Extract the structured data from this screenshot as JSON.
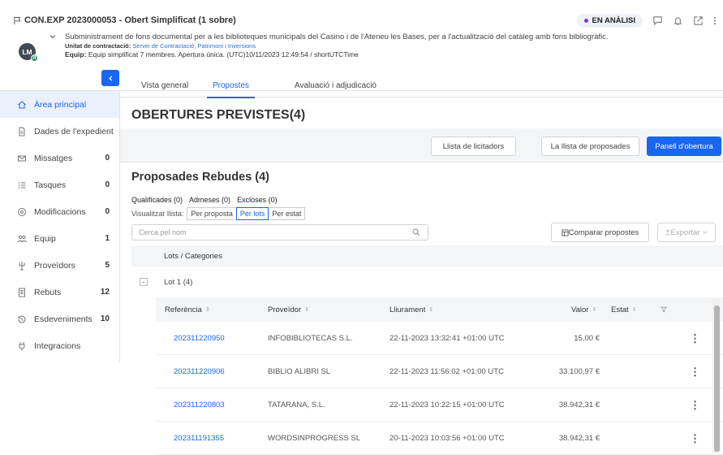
{
  "header": {
    "title": "CON.EXP 2023000053 - Obert Simplificat (1 sobre)",
    "status": "EN ANÀLISI",
    "status_color": "#7a3cc8",
    "avatar_initials": "LM",
    "avatar_sub": "R",
    "description": "Subministrament de fons documental per a les biblioteques municipals del Casino i de l'Ateneu les Bases, per a l'actualització del catàleg amb fons bibliogràfic.",
    "unit_label": "Unitat de contractació:",
    "unit_value": "Servei de Contractació, Patrimoni i Inversions",
    "team_label": "Equip:",
    "team_value": "Equip simplificat 7 membres. Apertura única. (UTC)10/11/2023 12:49:54 / shortUTCTime",
    "icons": [
      "flag-icon",
      "chat-icon",
      "bell-icon",
      "external-link-icon",
      "more-vertical-icon"
    ]
  },
  "sidebar": {
    "items": [
      {
        "label": "Àrea principal",
        "count": "",
        "icon": "home-icon"
      },
      {
        "label": "Dades de l'expedient",
        "count": "",
        "icon": "document-icon"
      },
      {
        "label": "Missatges",
        "count": "0",
        "icon": "mail-icon"
      },
      {
        "label": "Tasques",
        "count": "0",
        "icon": "tasks-icon"
      },
      {
        "label": "Modificacions",
        "count": "0",
        "icon": "modifications-icon"
      },
      {
        "label": "Equip",
        "count": "1",
        "icon": "team-icon"
      },
      {
        "label": "Proveïdors",
        "count": "5",
        "icon": "providers-icon"
      },
      {
        "label": "Rebuts",
        "count": "12",
        "icon": "receipt-icon"
      },
      {
        "label": "Esdeveniments",
        "count": "10",
        "icon": "history-icon"
      },
      {
        "label": "Integracions",
        "count": "",
        "icon": "integrations-icon"
      }
    ]
  },
  "tabs": [
    {
      "label": "Vista general"
    },
    {
      "label": "Propostes"
    },
    {
      "label": "Avaluació i adjudicació"
    }
  ],
  "obertures": {
    "title": "OBERTURES PREVISTES(4)",
    "btn_licitadors": "Llista de licitadors",
    "btn_proposades": "La llista de proposades",
    "btn_panell": "Panell d'obertura"
  },
  "rebudes": {
    "title": "Proposades Rebudes (4)",
    "filter_qualificades": "Qualificades (0)",
    "filter_admeses": "Admeses (0)",
    "filter_excloses": "Excloses (0)",
    "visualitzar_label": "Visualitzar llista:",
    "view_options": [
      "Per proposta",
      "Per lots",
      "Per estat"
    ],
    "selected_view": "Per lots",
    "search_placeholder": "Cerca pel nom",
    "btn_comparar": "Comparar propostes",
    "btn_exportar": "Exportar"
  },
  "lots": {
    "header": "Lots / Categories",
    "lot_label": "Lot 1 (4)",
    "expand_symbol": "-"
  },
  "table": {
    "columns": {
      "referencia": "Referència",
      "proveidor": "Proveïdor",
      "lliurament": "Lliurament",
      "valor": "Valor",
      "estat": "Estat"
    },
    "rows": [
      {
        "ref": "202311220950",
        "proveidor": "INFOBIBLIOTECAS S.L.",
        "lliurament": "22-11-2023 13:32:41 +01:00 UTC",
        "valor": "15,00 €"
      },
      {
        "ref": "202311220906",
        "proveidor": "BIBLIO ALIBRI SL",
        "lliurament": "22-11-2023 11:56:02 +01:00 UTC",
        "valor": "33.100,97 €"
      },
      {
        "ref": "202311220803",
        "proveidor": "TATARANA, S.L.",
        "lliurament": "22-11-2023 10:22:15 +01:00 UTC",
        "valor": "38.942,31 €"
      },
      {
        "ref": "202311191355",
        "proveidor": "WORDSINPROGRESS SL",
        "lliurament": "20-11-2023 10:03:56 +01:00 UTC",
        "valor": "38.942,31 €"
      }
    ]
  },
  "colors": {
    "accent": "#1a66f0"
  }
}
